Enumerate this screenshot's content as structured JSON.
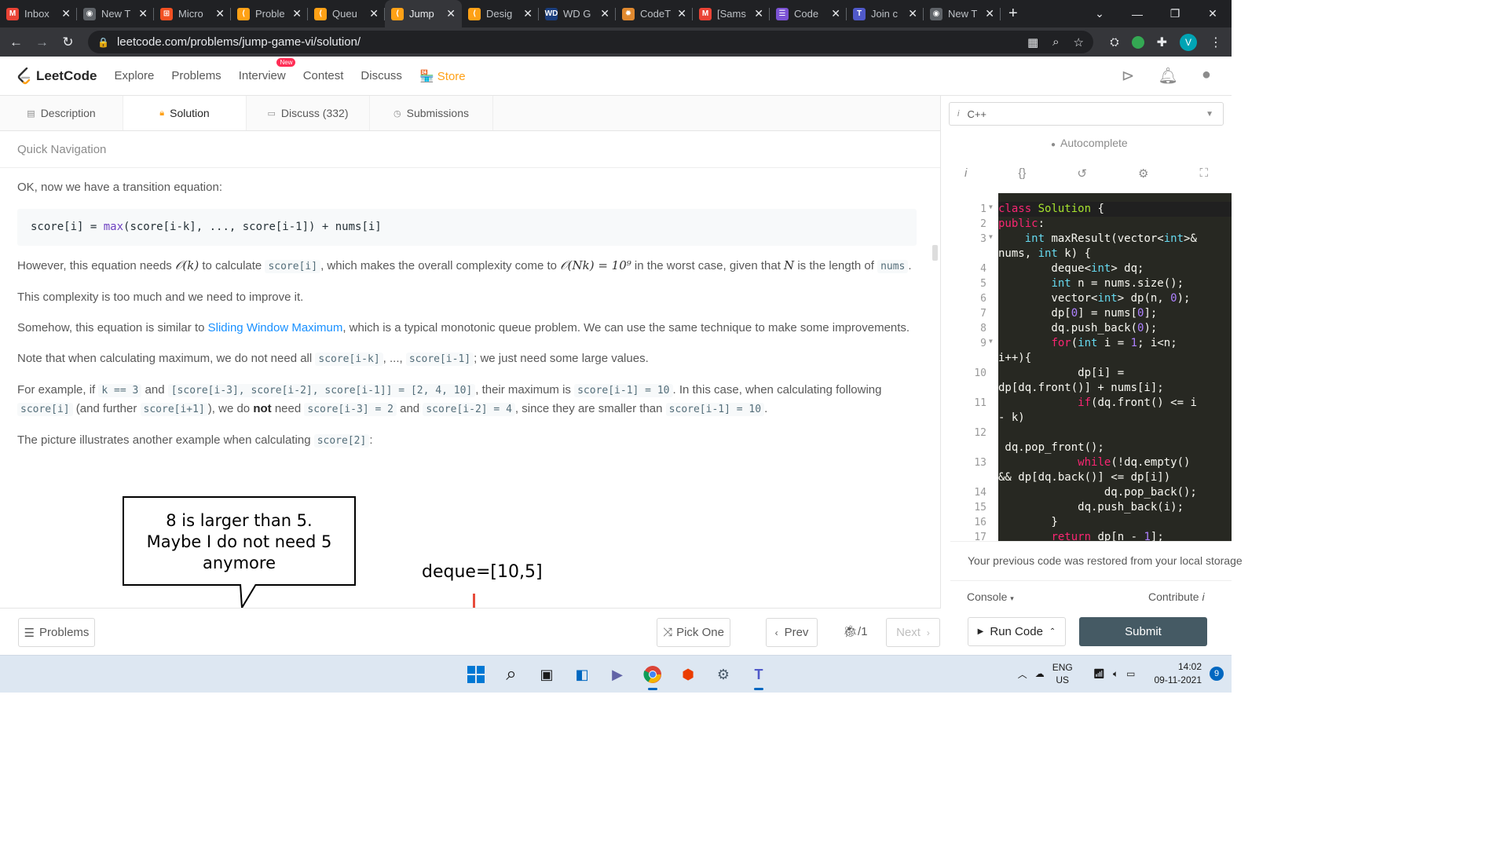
{
  "browser": {
    "tabs": [
      {
        "label": "Inbox",
        "icon": "gmail-icon",
        "color": "#ea4335"
      },
      {
        "label": "New T",
        "icon": "chrome-icon",
        "color": "#5f6368"
      },
      {
        "label": "Micro",
        "icon": "microsoft-icon",
        "color": "#f25022"
      },
      {
        "label": "Proble",
        "icon": "leetcode-icon",
        "color": "#ffa116"
      },
      {
        "label": "Queu",
        "icon": "leetcode-icon",
        "color": "#ffa116"
      },
      {
        "label": "Jump",
        "icon": "leetcode-icon",
        "color": "#ffa116"
      },
      {
        "label": "Desig",
        "icon": "leetcode-icon",
        "color": "#ffa116"
      },
      {
        "label": "WD G",
        "icon": "wd-icon",
        "color": "#1a3d7c"
      },
      {
        "label": "CodeT",
        "icon": "codechef-icon",
        "color": "#e0892f"
      },
      {
        "label": "[Sams",
        "icon": "gmail-icon",
        "color": "#ea4335"
      },
      {
        "label": "Code",
        "icon": "form-icon",
        "color": "#7b52d3"
      },
      {
        "label": "Join c",
        "icon": "teams-icon",
        "color": "#5059c9"
      },
      {
        "label": "New T",
        "icon": "chrome-icon",
        "color": "#5f6368"
      }
    ],
    "active_tab_index": 5,
    "url": "leetcode.com/problems/jump-game-vi/solution/",
    "profile_initial": "V"
  },
  "header": {
    "logo_text": "LeetCode",
    "nav": [
      "Explore",
      "Problems",
      "Interview",
      "Contest",
      "Discuss",
      "Store"
    ],
    "new_badge": "New"
  },
  "left_tabs": [
    {
      "label": "Description",
      "icon": "description-icon"
    },
    {
      "label": "Solution",
      "icon": "solution-icon"
    },
    {
      "label": "Discuss (332)",
      "icon": "discuss-icon"
    },
    {
      "label": "Submissions",
      "icon": "submissions-icon"
    }
  ],
  "quick_nav": "Quick Navigation",
  "article": {
    "p1": "OK, now we have a transition equation:",
    "equation": {
      "pre": "score[i] = ",
      "fn": "max",
      "post": "(score[i-k], ..., score[i-1]) + nums[i]"
    },
    "p2": {
      "a": "However, this equation needs ",
      "m1": "𝒪(k)",
      "b": " to calculate ",
      "c1": "score[i]",
      "c": ", which makes the overall complexity come to ",
      "m2": "𝒪(Nk) = 10⁹",
      "d": " in the worst case, given that ",
      "m3": "N",
      "e": " is the length of ",
      "c2": "nums",
      "f": "."
    },
    "p3": "This complexity is too much and we need to improve it.",
    "p4": {
      "a": "Somehow, this equation is similar to ",
      "link": "Sliding Window Maximum",
      "b": ", which is a typical monotonic queue problem. We can use the same technique to make some improvements."
    },
    "p5": {
      "a": "Note that when calculating maximum, we do not need all ",
      "c1": "score[i-k]",
      "b": ", ..., ",
      "c2": "score[i-1]",
      "c": "; we just need some large values."
    },
    "p6": {
      "a": "For example, if ",
      "c1": "k == 3",
      "b": " and ",
      "c2": "[score[i-3], score[i-2], score[i-1]] = [2, 4, 10]",
      "c": ", their maximum is ",
      "c3": "score[i-1] = 10",
      "d": ". In this case, when calculating following ",
      "c4": "score[i]",
      "e": " (and further ",
      "c5": "score[i+1]",
      "f": "), we do ",
      "bold": "not",
      "g": " need ",
      "c6": "score[i-3] = 2",
      "h": " and ",
      "c7": "score[i-2] = 4",
      "i": ", since they are smaller than ",
      "c8": "score[i-1] = 10",
      "j": "."
    },
    "p7": {
      "a": "The picture illustrates another example when calculating ",
      "c1": "score[2]",
      "b": ":"
    },
    "picture": {
      "bubble_lines": [
        "8 is larger than 5.",
        "Maybe I do not need 5",
        "anymore"
      ],
      "deque_label": "deque=[10,5]"
    }
  },
  "left_bottom": {
    "problems": "Problems",
    "pick_one": "Pick One",
    "prev": "Prev",
    "page": "/1",
    "next": "Next"
  },
  "editor": {
    "language": "C++",
    "autocomplete": "Autocomplete",
    "line_numbers": [
      "1",
      "2",
      "3",
      "4",
      "5",
      "6",
      "7",
      "8",
      "9",
      "10",
      "11",
      "12",
      "13",
      "14",
      "15",
      "16",
      "17"
    ],
    "restored_msg": "Your previous code was restored from your local storage",
    "console": "Console",
    "contribute": "Contribute",
    "run": "Run Code",
    "submit": "Submit"
  },
  "taskbar": {
    "lang1": "ENG",
    "lang2": "US",
    "time": "14:02",
    "date": "09-11-2021",
    "notif_count": "9"
  }
}
